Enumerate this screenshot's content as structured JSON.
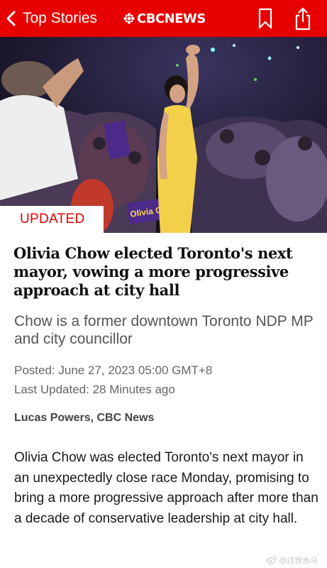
{
  "topbar": {
    "back_label": "Top Stories",
    "brand_text": "CBCNEWS",
    "accent_color": "#e60000",
    "icons": [
      "back-chevron-icon",
      "cbc-gem-logo-icon",
      "bookmark-icon",
      "share-icon"
    ]
  },
  "hero": {
    "badge": "UPDATED",
    "info_icon": "i",
    "sign_text": "Olivia Chow"
  },
  "article": {
    "headline": "Olivia Chow elected Toronto's next mayor, vowing a more progressive approach at city hall",
    "subhead": "Chow is a former downtown Toronto NDP MP and city councillor",
    "posted": "Posted: June 27, 2023 05:00 GMT+8",
    "last_updated": "Last Updated: 28 Minutes ago",
    "byline": "Lucas Powers, CBC News",
    "body": "Olivia Chow was elected Toronto's next mayor in an unexpectedly close race Monday, promising to bring a more progressive approach after more than a decade of conservative leadership at city hall."
  },
  "watermark": {
    "text": "@过世水马"
  }
}
